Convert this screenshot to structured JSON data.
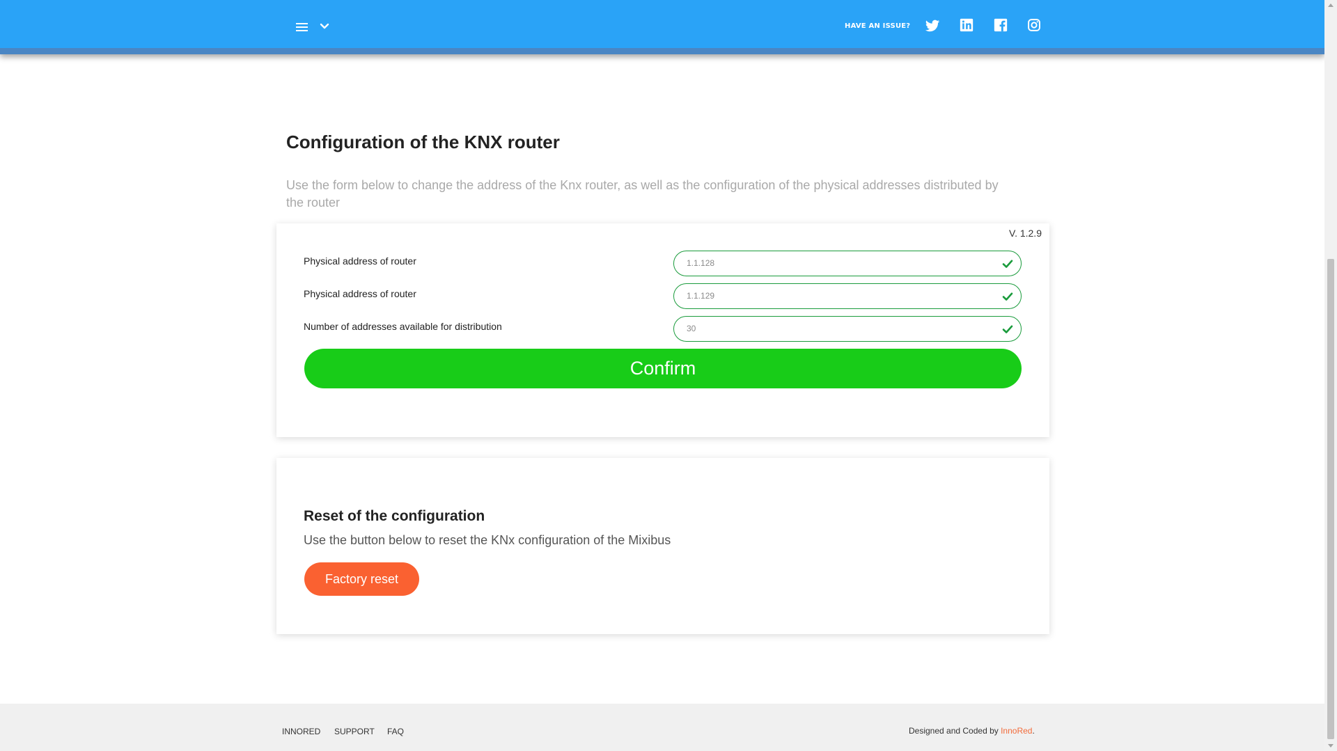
{
  "header": {
    "issue_label": "HAVE AN ISSUE?",
    "social": [
      "twitter-icon",
      "linkedin-icon",
      "facebook-icon",
      "instagram-icon"
    ],
    "bg_color": "#2aa3f7"
  },
  "main": {
    "title": "Configuration of the KNX router",
    "subtitle": "Use the form below to change the address of the Knx router, as well as the configuration of the physical addresses distributed by the router",
    "config_card": {
      "version": "V. 1.2.9",
      "fields": [
        {
          "label": "Physical address of router",
          "value": "1.1.128"
        },
        {
          "label": "Physical address of router",
          "value": "1.1.129"
        },
        {
          "label": "Number of addresses available for distribution",
          "value": "30"
        }
      ],
      "confirm_label": "Confirm"
    },
    "reset_card": {
      "title": "Reset of the configuration",
      "description": "Use the button below to reset the KNx configuration of the Mixibus",
      "button_label": "Factory reset"
    }
  },
  "footer": {
    "links": [
      "INNORED",
      "SUPPORT",
      "FAQ"
    ],
    "credit_prefix": "Designed and Coded by ",
    "credit_brand": "InnoRed",
    "credit_suffix": "."
  },
  "colors": {
    "header": "#2aa3f7",
    "confirm": "#18cc18",
    "reset": "#fa6131",
    "valid": "#1a9b3c"
  }
}
